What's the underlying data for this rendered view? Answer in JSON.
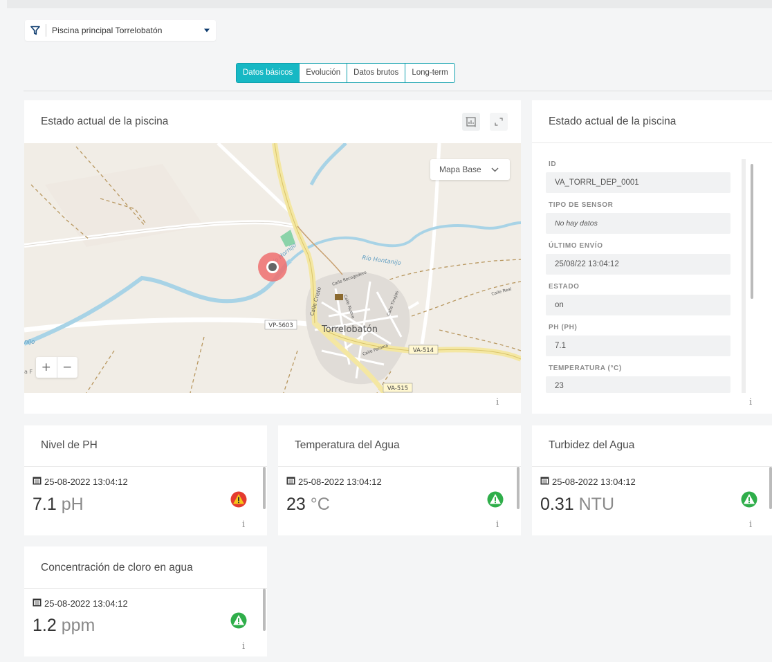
{
  "filter": {
    "label": "Piscina principal Torrelobatón",
    "icon": "filter-icon"
  },
  "tabs": [
    {
      "label": "Datos básicos",
      "active": true
    },
    {
      "label": "Evolución",
      "active": false
    },
    {
      "label": "Datos brutos",
      "active": false
    },
    {
      "label": "Long-term",
      "active": false
    }
  ],
  "map_card": {
    "title": "Estado actual de la piscina",
    "map_base_label": "Mapa Base",
    "zoom_in": "+",
    "zoom_out": "−",
    "info": "i",
    "labels": {
      "river1": "Río Hontanijo",
      "river2": "Río Hornijo",
      "road_vp": "VP-5603",
      "road_va514": "VA-514",
      "road_va515": "VA-515",
      "town": "Torrelobatón",
      "street1": "Calle Cristo",
      "street2": "Calle Recogedero",
      "street3": "Calle Real",
      "street4": "Calle Paloma",
      "street5": "Calle Tinajas",
      "street6": "Calle Nueva",
      "partial_left": "nijo",
      "partial_left2": "a F"
    }
  },
  "detail_card": {
    "title": "Estado actual de la piscina",
    "info": "i",
    "fields": [
      {
        "label": "ID",
        "value": "VA_TORRL_DEP_0001",
        "italic": false
      },
      {
        "label": "TIPO DE SENSOR",
        "value": "No hay datos",
        "italic": true
      },
      {
        "label": "ÚLTIMO ENVÍO",
        "value": "25/08/22 13:04:12",
        "italic": false
      },
      {
        "label": "ESTADO",
        "value": "on",
        "italic": false
      },
      {
        "label": "PH (PH)",
        "value": "7.1",
        "italic": false
      },
      {
        "label": "TEMPERATURA (°C)",
        "value": "23",
        "italic": false
      }
    ]
  },
  "metrics": [
    {
      "title": "Nivel de PH",
      "timestamp": "25-08-2022 13:04:12",
      "value": "7.1",
      "unit": "pH",
      "status": "warning",
      "status_color": "#e53b2f",
      "info": "i"
    },
    {
      "title": "Temperatura del Agua",
      "timestamp": "25-08-2022 13:04:12",
      "value": "23",
      "unit": "°C",
      "status": "ok",
      "status_color": "#2fae4a",
      "info": "i"
    },
    {
      "title": "Turbidez del Agua",
      "timestamp": "25-08-2022 13:04:12",
      "value": "0.31",
      "unit": "NTU",
      "status": "ok",
      "status_color": "#2fae4a",
      "info": "i"
    },
    {
      "title": "Concentración de cloro en agua",
      "timestamp": "25-08-2022 13:04:12",
      "value": "1.2",
      "unit": "ppm",
      "status": "ok",
      "status_color": "#2fae4a",
      "info": "i"
    }
  ],
  "colors": {
    "accent": "#17b8c4",
    "warning_red": "#e53b2f",
    "warning_yellow": "#f5c518",
    "ok_green": "#2fae4a"
  }
}
